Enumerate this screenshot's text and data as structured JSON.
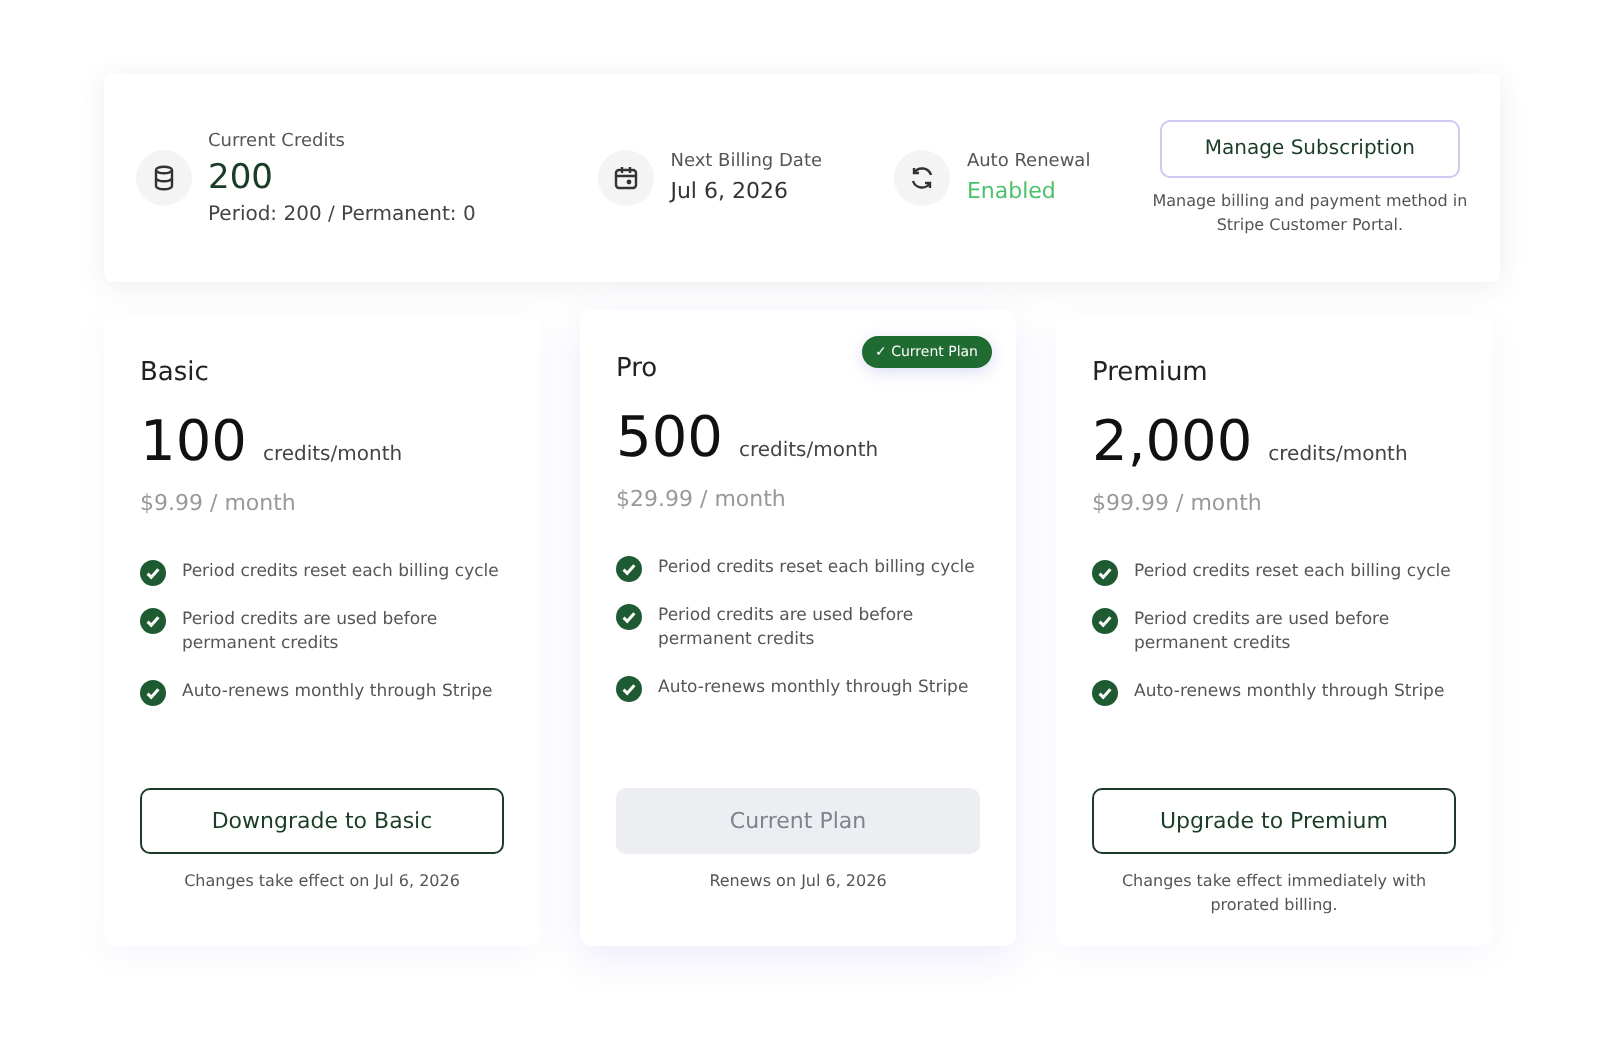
{
  "summary": {
    "credits": {
      "label": "Current Credits",
      "value": "200",
      "detail": "Period: 200 / Permanent: 0"
    },
    "billing": {
      "label": "Next Billing Date",
      "value": "Jul 6, 2026"
    },
    "renewal": {
      "label": "Auto Renewal",
      "value": "Enabled",
      "enabled": true
    },
    "manage": {
      "button": "Manage Subscription",
      "note": "Manage billing and payment method in Stripe Customer Portal."
    }
  },
  "plans": [
    {
      "name": "Basic",
      "credits": "100",
      "unit": "credits/month",
      "price": "$9.99 / month",
      "current": false,
      "features": [
        "Period credits reset each billing cycle",
        "Period credits are used before permanent credits",
        "Auto-renews monthly through Stripe"
      ],
      "button": "Downgrade to Basic",
      "disabled": false,
      "note": "Changes take effect on Jul 6, 2026"
    },
    {
      "name": "Pro",
      "credits": "500",
      "unit": "credits/month",
      "price": "$29.99 / month",
      "current": true,
      "badge": "✓ Current Plan",
      "features": [
        "Period credits reset each billing cycle",
        "Period credits are used before permanent credits",
        "Auto-renews monthly through Stripe"
      ],
      "button": "Current Plan",
      "disabled": true,
      "note": "Renews on Jul 6, 2026"
    },
    {
      "name": "Premium",
      "credits": "2,000",
      "unit": "credits/month",
      "price": "$99.99 / month",
      "current": false,
      "features": [
        "Period credits reset each billing cycle",
        "Period credits are used before permanent credits",
        "Auto-renews monthly through Stripe"
      ],
      "button": "Upgrade to Premium",
      "disabled": false,
      "note": "Changes take effect immediately with prorated billing."
    }
  ]
}
